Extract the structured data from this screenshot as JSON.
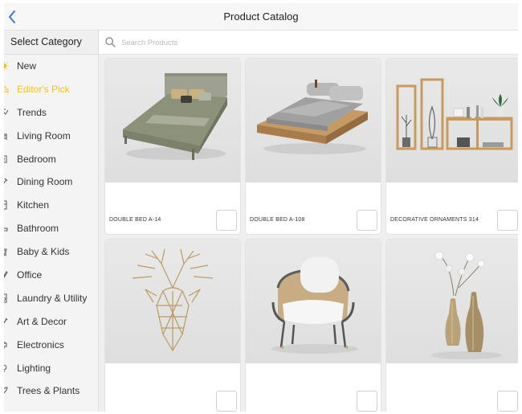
{
  "header": {
    "title": "Product Catalog",
    "back_icon": "chevron-left-icon"
  },
  "sidebar": {
    "title": "Select Category",
    "active_color": "#f2c40f",
    "items": [
      {
        "label": "New",
        "icon": "sun-icon"
      },
      {
        "label": "Editor's Pick",
        "icon": "bed-icon",
        "active": true
      },
      {
        "label": "Trends",
        "icon": "trend-icon"
      },
      {
        "label": "Living Room",
        "icon": "sofa-icon"
      },
      {
        "label": "Bedroom",
        "icon": "bed-icon"
      },
      {
        "label": "Dining Room",
        "icon": "utensils-icon"
      },
      {
        "label": "Kitchen",
        "icon": "fridge-icon"
      },
      {
        "label": "Bathroom",
        "icon": "bathtub-icon"
      },
      {
        "label": "Baby & Kids",
        "icon": "stroller-icon"
      },
      {
        "label": "Office",
        "icon": "pen-icon"
      },
      {
        "label": "Laundry & Utility",
        "icon": "washer-icon"
      },
      {
        "label": "Art & Decor",
        "icon": "brush-icon"
      },
      {
        "label": "Electronics",
        "icon": "plug-icon"
      },
      {
        "label": "Lighting",
        "icon": "bulb-icon"
      },
      {
        "label": "Trees & Plants",
        "icon": "leaf-icon"
      }
    ]
  },
  "search": {
    "placeholder": "Search Products",
    "value": ""
  },
  "products": [
    {
      "name": "DOUBLE BED A-14"
    },
    {
      "name": "DOUBLE BED A-108"
    },
    {
      "name": "DECORATIVE ORNAMENTS 314"
    },
    {
      "name": ""
    },
    {
      "name": ""
    },
    {
      "name": ""
    }
  ]
}
